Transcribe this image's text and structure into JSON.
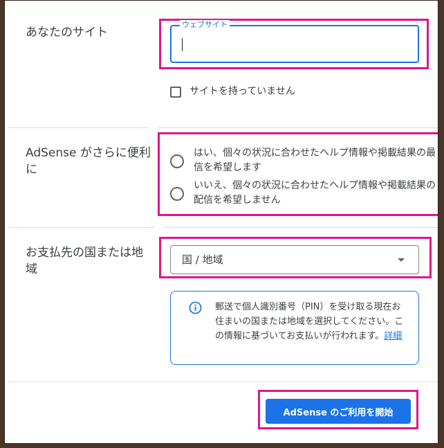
{
  "sections": {
    "website": {
      "label": "あなたのサイト",
      "field_label": "ウェブサイト",
      "value": "",
      "checkbox_label": "サイトを持っていません"
    },
    "notifications": {
      "label_line1": "AdSense がさらに便利",
      "label_line2": "に",
      "option_yes_line1": "はい、個々の状況に合わせたヘルプ情報や掲載結果の最",
      "option_yes_line2": "信を希望します",
      "option_no_line1": "いいえ、個々の状況に合わせたヘルプ情報や掲載結果の",
      "option_no_line2": "配信を希望しません"
    },
    "country": {
      "label_line1": "お支払先の国または地",
      "label_line2": "域",
      "select_value": "国 / 地域",
      "info_text": "郵送で個人識別番号（PIN）を受け取る現在お住まいの国または地域を選択してください。この情報に基づいてお支払いが行われます。",
      "info_link": "詳細"
    }
  },
  "footer": {
    "start_button_label": "AdSense のご利用を開始"
  },
  "colors": {
    "accent": "#1a73e8",
    "highlight": "#e0148c",
    "frame": "#4a3526"
  },
  "icons": {
    "info": "info-icon",
    "dropdown": "chevron-down-icon"
  }
}
